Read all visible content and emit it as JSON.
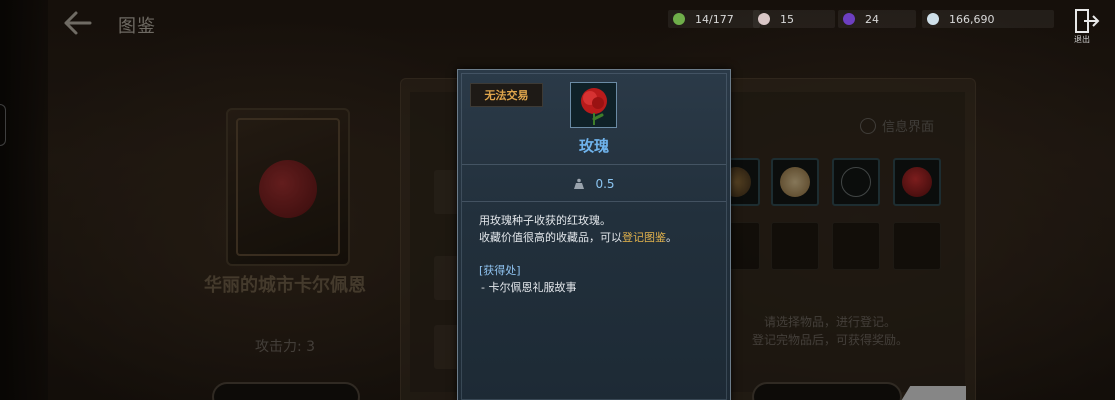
{
  "header": {
    "title": "图鉴",
    "resources": [
      {
        "name": "collection-count",
        "value": "14/177",
        "icon": "green-gem-icon",
        "color": "#6fae4a"
      },
      {
        "name": "pearl",
        "value": "15",
        "icon": "pearl-icon",
        "color": "#d9c6c6"
      },
      {
        "name": "purple-orb",
        "value": "24",
        "icon": "purple-orb-icon",
        "color": "#6d3fc1"
      },
      {
        "name": "silver-coin",
        "value": "166,690",
        "icon": "silver-coin-icon",
        "color": "#cfe0ea"
      }
    ],
    "exit_label": "退出"
  },
  "left_card": {
    "name": "华丽的城市卡尔佩恩",
    "attack": "攻击力: 3"
  },
  "right_panel": {
    "info_toggle_label": "信息界面",
    "note_line1": "请选择物品，进行登记。",
    "note_line2": "登记完物品后，可获得奖励。"
  },
  "tooltip": {
    "badge": "无法交易",
    "item_name": "玫瑰",
    "weight_value": "0.5",
    "desc_line1": "用玫瑰种子收获的红玫瑰。",
    "desc_line2_prefix": "收藏价值很高的收藏品，可以",
    "desc_line2_highlight": "登记图鉴",
    "desc_line2_suffix": "。",
    "source_label": "[获得处]",
    "source_item": "- 卡尔佩恩礼服故事"
  },
  "colors": {
    "item_name": "#6fb3ec",
    "badge_text": "#e0a64c",
    "highlight": "#e2b24c"
  }
}
